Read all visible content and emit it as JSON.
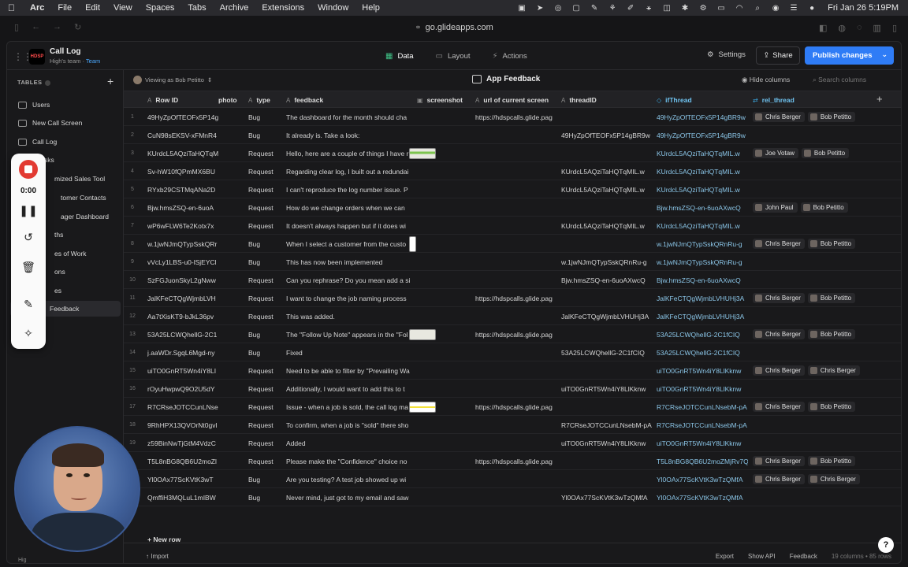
{
  "menubar": {
    "app": "Arc",
    "items": [
      "File",
      "Edit",
      "View",
      "Spaces",
      "Tabs",
      "Archive",
      "Extensions",
      "Window",
      "Help"
    ],
    "clock": "Fri Jan 26  5:19PM"
  },
  "browser": {
    "url": "go.glideapps.com"
  },
  "topbar": {
    "app_name": "Call Log",
    "team_prefix": "High's team · ",
    "team_link": "Team",
    "tabs": [
      "Data",
      "Layout",
      "Actions"
    ],
    "settings": "Settings",
    "share": "Share",
    "publish": "Publish changes"
  },
  "sidebar": {
    "heading": "TABLES",
    "items": [
      "Users",
      "New Call Screen",
      "Call Log",
      "Tasks",
      "mized Sales Tool",
      "tomer Contacts",
      "ager Dashboard",
      "ths",
      "es of Work",
      "ons",
      "es",
      "Feedback"
    ],
    "footer": "Hig"
  },
  "recorder": {
    "time": "0:00"
  },
  "pane": {
    "viewing": "Viewing as Bob Petitto",
    "table_name": "App Feedback",
    "hide_columns": "Hide columns",
    "search_placeholder": "Search columns",
    "new_row": "New row",
    "import": "Import",
    "export": "Export",
    "show_api": "Show API",
    "feedback": "Feedback",
    "count": "19 columns • 85 rows"
  },
  "columns": [
    {
      "label": "Row ID",
      "type": "A"
    },
    {
      "label": "photo",
      "type": ""
    },
    {
      "label": "type",
      "type": "A"
    },
    {
      "label": "feedback",
      "type": "A"
    },
    {
      "label": "screenshot",
      "type": "▣"
    },
    {
      "label": "url of current screen",
      "type": "A"
    },
    {
      "label": "threadID",
      "type": "A"
    },
    {
      "label": "ifThread",
      "type": "◇"
    },
    {
      "label": "rel_thread",
      "type": "⇄"
    }
  ],
  "rows": [
    {
      "n": "1",
      "id": "49HyZpOfTEOFx5P14g",
      "type": "Bug",
      "fb": "The dashboard for the month should cha",
      "shot": "",
      "url": "https://hdspcalls.glide.pag",
      "tid": "",
      "if": "49HyZpOfTEOFx5P14gBR9w",
      "rel": [
        "Chris Berger",
        "Bob Petitto"
      ]
    },
    {
      "n": "2",
      "id": "CuN98sEKSV-xFMnR4",
      "type": "Bug",
      "fb": "It already is. Take a look:",
      "shot": "",
      "url": "",
      "tid": "49HyZpOfTEOFx5P14gBR9w",
      "if": "49HyZpOfTEOFx5P14gBR9w",
      "rel": []
    },
    {
      "n": "3",
      "id": "KUrdcL5AQziTaHQTqM",
      "type": "Request",
      "fb": "Hello, here are a couple of things I have r",
      "shot": "g",
      "url": "",
      "tid": "",
      "if": "KUrdcL5AQziTaHQTqMIL.w",
      "rel": [
        "Joe Votaw",
        "Bob Petitto"
      ]
    },
    {
      "n": "4",
      "id": "Sv-hW10fQPmMX6BU",
      "type": "Request",
      "fb": "Regarding clear log, I built out a redundai",
      "shot": "",
      "url": "",
      "tid": "KUrdcL5AQziTaHQTqMIL.w",
      "if": "KUrdcL5AQziTaHQTqMIL.w",
      "rel": []
    },
    {
      "n": "5",
      "id": "RYxb29CSTMqANa2D",
      "type": "Request",
      "fb": "I can't reproduce the log number issue. P",
      "shot": "",
      "url": "",
      "tid": "KUrdcL5AQziTaHQTqMIL.w",
      "if": "KUrdcL5AQziTaHQTqMIL.w",
      "rel": []
    },
    {
      "n": "6",
      "id": "Bjw.hmsZSQ-en-6uoA",
      "type": "Request",
      "fb": "How do we change orders when we can",
      "shot": "",
      "url": "",
      "tid": "",
      "if": "Bjw.hmsZSQ-en-6uoAXwcQ",
      "rel": [
        "John Paul",
        "Bob Petitto"
      ]
    },
    {
      "n": "7",
      "id": "wP6wFLW6Te2Kotx7x",
      "type": "Request",
      "fb": "It doesn't always happen but if it does wi",
      "shot": "",
      "url": "",
      "tid": "KUrdcL5AQziTaHQTqMIL.w",
      "if": "KUrdcL5AQziTaHQTqMIL.w",
      "rel": []
    },
    {
      "n": "8",
      "id": "w.1jwNJmQTypSskQRr",
      "type": "Bug",
      "fb": "When I select a customer from the custo",
      "shot": "s",
      "url": "",
      "tid": "",
      "if": "w.1jwNJmQTypSskQRnRu-g",
      "rel": [
        "Chris Berger",
        "Bob Petitto"
      ]
    },
    {
      "n": "9",
      "id": "vVcLy1LBS-u0-lSjEYCl",
      "type": "Bug",
      "fb": "This has now been implemented",
      "shot": "",
      "url": "",
      "tid": "w.1jwNJmQTypSskQRnRu-g",
      "if": "w.1jwNJmQTypSskQRnRu-g",
      "rel": []
    },
    {
      "n": "10",
      "id": "SzFGJuonSkyL2gNww",
      "type": "Request",
      "fb": "Can you rephrase? Do you mean add a si",
      "shot": "",
      "url": "",
      "tid": "Bjw.hmsZSQ-en-6uoAXwcQ",
      "if": "Bjw.hmsZSQ-en-6uoAXwcQ",
      "rel": []
    },
    {
      "n": "11",
      "id": "JalKFeCTQgWjmbLVH",
      "type": "Request",
      "fb": "I want to change the job naming process",
      "shot": "",
      "url": "https://hdspcalls.glide.pag",
      "tid": "",
      "if": "JalKFeCTQgWjmbLVHUHj3A",
      "rel": [
        "Chris Berger",
        "Bob Petitto"
      ]
    },
    {
      "n": "12",
      "id": "Aa7tXisKT9-bJkL36pv",
      "type": "Request",
      "fb": "This was added.",
      "shot": "",
      "url": "",
      "tid": "JalKFeCTQgWjmbLVHUHj3A",
      "if": "JalKFeCTQgWjmbLVHUHj3A",
      "rel": []
    },
    {
      "n": "13",
      "id": "53A25LCWQhellG-2C1",
      "type": "Bug",
      "fb": "The \"Follow Up Note\" appears in the \"Fol",
      "shot": "w",
      "url": "https://hdspcalls.glide.pag",
      "tid": "",
      "if": "53A25LCWQhellG-2C1fCIQ",
      "rel": [
        "Chris Berger",
        "Bob Petitto"
      ]
    },
    {
      "n": "14",
      "id": "j.aaWDr.SgqL6Mgd-ny",
      "type": "Bug",
      "fb": "Fixed",
      "shot": "",
      "url": "",
      "tid": "53A25LCWQhellG-2C1fCIQ",
      "if": "53A25LCWQhellG-2C1fCIQ",
      "rel": []
    },
    {
      "n": "15",
      "id": "uiTO0GnRT5Wn4iY8LI",
      "type": "Request",
      "fb": "Need to be able to filter by \"Prevailing Wa",
      "shot": "",
      "url": "",
      "tid": "",
      "if": "uiTO0GnRT5Wn4iY8LlKknw",
      "rel": [
        "Chris Berger",
        "Chris Berger"
      ]
    },
    {
      "n": "16",
      "id": "rOyuHwpwQ9O2U5dY",
      "type": "Request",
      "fb": "Additionally, I would want to add this to t",
      "shot": "",
      "url": "",
      "tid": "uiTO0GnRT5Wn4iY8LlKknw",
      "if": "uiTO0GnRT5Wn4iY8LlKknw",
      "rel": []
    },
    {
      "n": "17",
      "id": "R7CRseJOTCCunLNse",
      "type": "Request",
      "fb": "Issue - when a job is sold, the call log ma",
      "shot": "y",
      "url": "https://hdspcalls.glide.pag",
      "tid": "",
      "if": "R7CRseJOTCCunLNsebM-pA",
      "rel": [
        "Chris Berger",
        "Bob Petitto"
      ]
    },
    {
      "n": "18",
      "id": "9RhHPX13QVOrNt0gvl",
      "type": "Request",
      "fb": "To confirm, when a job is \"sold\" there sho",
      "shot": "",
      "url": "",
      "tid": "R7CRseJOTCCunLNsebM-pA",
      "if": "R7CRseJOTCCunLNsebM-pA",
      "rel": []
    },
    {
      "n": "19",
      "id": "z59BinNwTjGtM4VdzC",
      "type": "Request",
      "fb": "Added",
      "shot": "",
      "url": "",
      "tid": "uiTO0GnRT5Wn4iY8LlKknw",
      "if": "uiTO0GnRT5Wn4iY8LlKknw",
      "rel": []
    },
    {
      "n": "",
      "id": "T5L8nBG8QB6U2moZl",
      "type": "Request",
      "fb": "Please make the \"Confidence\" choice no",
      "shot": "",
      "url": "https://hdspcalls.glide.pag",
      "tid": "",
      "if": "T5L8nBG8QB6U2moZMjRv7Q",
      "rel": [
        "Chris Berger",
        "Bob Petitto"
      ]
    },
    {
      "n": "",
      "id": "Yl0OAx77ScKVtK3wT",
      "type": "Bug",
      "fb": "Are you testing? A test job showed up wi",
      "shot": "",
      "url": "",
      "tid": "",
      "if": "Yl0OAx77ScKVtK3wTzQMfA",
      "rel": [
        "Chris Berger",
        "Chris Berger"
      ]
    },
    {
      "n": "",
      "id": "QmffiH3MQLuL1mIBW",
      "type": "Bug",
      "fb": "Never mind, just got to my email and saw",
      "shot": "",
      "url": "",
      "tid": "Yl0OAx77ScKVtK3wTzQMfA",
      "if": "Yl0OAx77ScKVtK3wTzQMfA",
      "rel": []
    }
  ]
}
